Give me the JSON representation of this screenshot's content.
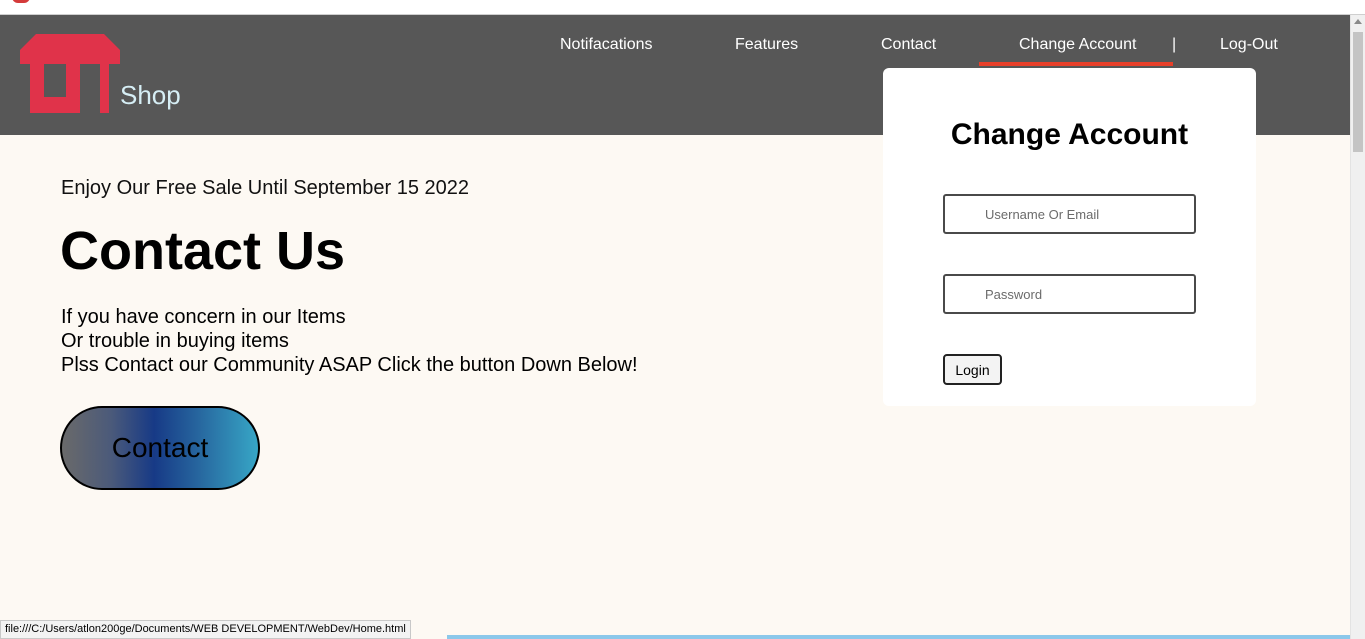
{
  "brand": {
    "shop_label": "Shop",
    "logo_icon": "shop-store-icon",
    "logo_color": "#e0334a"
  },
  "nav": {
    "items": [
      {
        "label": "Notifacations"
      },
      {
        "label": "Features"
      },
      {
        "label": "Contact"
      },
      {
        "label": "Change Account"
      },
      {
        "label": "Log-Out"
      }
    ],
    "separator": "|",
    "active_item": "Change Account",
    "active_underline_color": "#e8402a"
  },
  "main": {
    "promo": "Enjoy Our Free Sale Until September 15 2022",
    "title": "Contact Us",
    "body_lines": [
      "If you have concern in our Items",
      "Or trouble in buying items",
      "Plss Contact our Community ASAP Click the button Down Below!"
    ],
    "contact_button_label": "Contact"
  },
  "account_panel": {
    "title": "Change Account",
    "username_placeholder": "Username Or Email",
    "password_placeholder": "Password",
    "login_button_label": "Login"
  },
  "status_bar": {
    "url": "file:///C:/Users/atlon200ge/Documents/WEB DEVELOPMENT/WebDev/Home.html"
  },
  "colors": {
    "header_bg": "#575757",
    "page_bg": "#fdf9f3",
    "contact_gradient": [
      "#6a6a6a",
      "#173a86",
      "#37a6c6"
    ]
  }
}
